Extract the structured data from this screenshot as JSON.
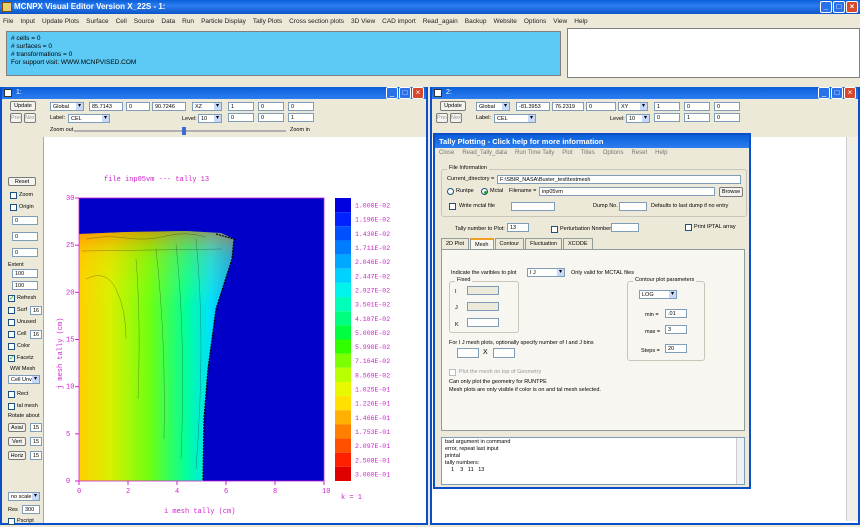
{
  "app": {
    "title": "MCNPX Visual Editor Version X_22S  - 1:"
  },
  "menu": [
    "File",
    "Input",
    "Update Plots",
    "Surface",
    "Cell",
    "Source",
    "Data",
    "Run",
    "Particle Display",
    "Tally Plots",
    "Cross section plots",
    "3D View",
    "CAD import",
    "Read_again",
    "Backup",
    "Website",
    "Options",
    "View",
    "Help"
  ],
  "messages": [
    "# cells = 0",
    "# surfaces = 0",
    "# transformations = 0",
    "For support visit: WWW.MCNPVISED.COM"
  ],
  "win1": {
    "title": "1:",
    "update": "Update",
    "prev": "Prev",
    "next": "Next",
    "reset": "Reset",
    "origin_mode": "Global",
    "x": "85.7143",
    "y": "0",
    "z": "90.7246",
    "plane": "XZ",
    "e1": "1",
    "e2": "0",
    "e3": "0",
    "e4": "0",
    "e5": "0",
    "e6": "1",
    "label_text": "Label:",
    "label_value": "CEL",
    "level_text": "Level:",
    "level_value": "10",
    "zoom_out": "Zoom out",
    "zoom_in": "Zoom in",
    "side": {
      "zoom": "Zoom",
      "origin": "Origin",
      "f0a": "0",
      "f0b": "0",
      "f0c": "0",
      "extent_label": "Extent",
      "extent1": "100",
      "extent2": "100",
      "refresh": "Refresh",
      "surf": "Surf",
      "surf_v": "16",
      "unused": "Unused",
      "cell": "Cell",
      "cell_v": "16",
      "color": "Color",
      "facetz": "Facetz",
      "wwmesh": "WW Mesh",
      "cell_unv": "Cell Unv",
      "rect": "Rect",
      "talmesh": "tal mesh",
      "rotate": "Rotate about",
      "axial": "Axial",
      "axial_v": "15",
      "vert": "Vert",
      "vert_v": "15",
      "horiz": "Horiz",
      "horiz_v": "15",
      "noscale": "no scale",
      "res": "Res",
      "res_v": "300",
      "pscript": "Pscript"
    }
  },
  "plot": {
    "title": "file inp05vm  --- tally  13",
    "xlabel": "i mesh tally (cm)",
    "ylabel": "j mesh tally (cm)",
    "k_label": "k =   1",
    "xticks": [
      "0",
      "2",
      "4",
      "6",
      "8",
      "10"
    ],
    "yticks": [
      "0",
      "5",
      "10",
      "15",
      "20",
      "25",
      "30"
    ],
    "legend": [
      "1.000E-02",
      "1.196E-02",
      "1.430E-02",
      "1.711E-02",
      "2.046E-02",
      "2.447E-02",
      "2.927E-02",
      "3.501E-02",
      "4.187E-02",
      "5.008E-02",
      "5.990E-02",
      "7.164E-02",
      "8.569E-02",
      "1.025E-01",
      "1.226E-01",
      "1.466E-01",
      "1.753E-01",
      "2.097E-01",
      "2.508E-01",
      "3.000E-01"
    ],
    "colors": [
      "#0000e0",
      "#0022ff",
      "#0050ff",
      "#007cff",
      "#00a8ff",
      "#00d2ff",
      "#00f4ec",
      "#00ffb8",
      "#00ff80",
      "#00ff40",
      "#30ff00",
      "#7cff00",
      "#b8ff00",
      "#e8f800",
      "#ffe000",
      "#ffb000",
      "#ff8000",
      "#ff5000",
      "#ff2000",
      "#e00000"
    ]
  },
  "win2": {
    "title": "2:",
    "update": "Update",
    "prev": "Prev",
    "next": "Next",
    "origin_mode": "Global",
    "x": "-81.3953",
    "y": "76.2319",
    "z": "0",
    "plane": "XY",
    "e1": "1",
    "e2": "0",
    "e3": "0",
    "e4": "0",
    "e5": "1",
    "e6": "0",
    "label_text": "Label:",
    "label_value": "CEL",
    "level_text": "Level:",
    "level_value": "10",
    "zoom_out": "Zoom out"
  },
  "tally": {
    "title": "Tally Plotting  - Click help for more information",
    "menu": [
      "Close",
      "Read_Tally_data",
      "Run Time Tally",
      "Plot",
      "Titles",
      "Options",
      "Reset",
      "Help"
    ],
    "file_info": "File Information",
    "curdir_label": "Current_directory =",
    "curdir": "F:\\SBIR_NASA\\Buster_test\\testmesh",
    "runtpe": "Runtpe",
    "mctal": "Mctal",
    "filename_label": "Filename =",
    "filename": "inp05vm",
    "browse": "Browse",
    "write_mctal": "Write mctal file",
    "dump_label": "Dump No.",
    "dump_note": "Defaults to last dump if no entry",
    "tally_num_label": "Tally number to Plot:",
    "tally_num": "13",
    "pert_label": "Perturbation Nnmber:",
    "print_iptal": "Print IPTAL array",
    "tabs": [
      "2D Plot",
      "Mesh",
      "Contour",
      "Fluctuation",
      "XCODE"
    ],
    "indicate": "Indicate the varibles to plot",
    "var_select": "I J",
    "only_mctal": "Only valid for MCTAL files",
    "fixed": "Fixed",
    "fi": "I",
    "fj": "J",
    "fk": "K",
    "contour_params": "Contour plot parameters",
    "scale": "LOG",
    "min_label": "min =",
    ".min": "",
    "min": ".01",
    "max_label": "max =",
    "max": "3",
    "steps_label": "Steps =",
    "steps": "20",
    "ij_bins": "For I J mesh plots, optionally specify number of I and J bins",
    "x_sep": "X",
    "plot_mesh_geo": "Plot the mesh on top of Geometry",
    "only_geom": "Can only plot the geometry for RUNTPE",
    "mesh_visible": "Mesh plots are only visible if color is on and tal mesh selected.",
    "log": [
      "bad argument in command",
      "error, repeat last input",
      "printal",
      "tally numbers:",
      "    1    3   11   13"
    ]
  }
}
